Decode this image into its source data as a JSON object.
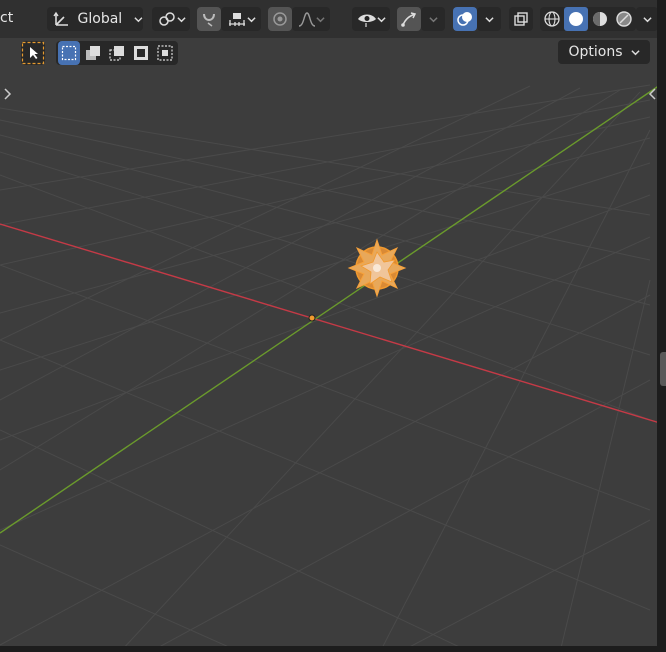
{
  "header": {
    "mode_label_partial": "ct",
    "transform_orientation": "Global",
    "options_label": "Options"
  },
  "icons": {
    "transform_orientation": "orientation-axes-icon",
    "pivot": "link-pivot-icon",
    "snap_magnet": "magnet-snap-icon",
    "snap_target": "snap-increment-icon",
    "proportional": "proportional-edit-icon",
    "falloff": "falloff-curve-icon",
    "visibility": "eye-visibility-icon",
    "gizmo": "gizmo-arrow-icon",
    "overlay": "overlay-icon",
    "xray": "xray-toggle-icon",
    "shading_wire": "wireframe-shading-icon",
    "shading_solid": "solid-shading-icon",
    "shading_material": "material-preview-icon",
    "shading_render": "rendered-shading-icon",
    "select_tool": "cursor-select-icon"
  },
  "colors": {
    "viewport_bg": "#3d3d3d",
    "x_axis": "#c43a46",
    "y_axis": "#6a9a2c",
    "selection_orange": "#f29a2e",
    "active_blue": "#4772b3"
  }
}
